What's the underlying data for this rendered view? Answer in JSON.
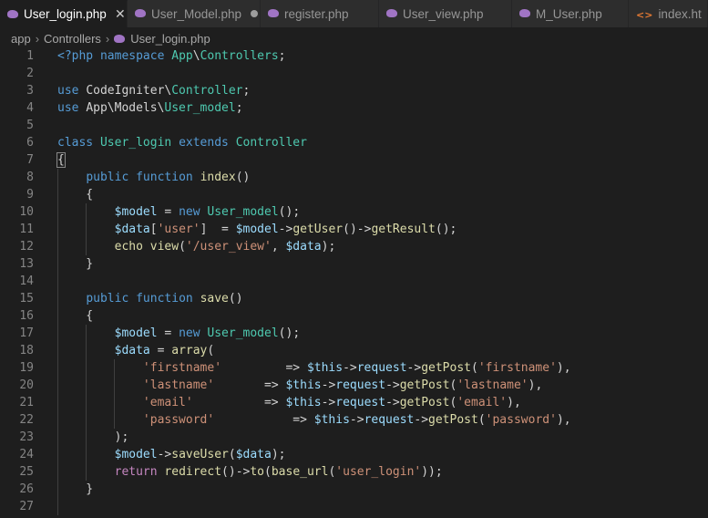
{
  "tabs": [
    {
      "label": "User_login.php",
      "icon": "php-file-icon",
      "active": true,
      "state": "close"
    },
    {
      "label": "User_Model.php",
      "icon": "php-file-icon",
      "active": false,
      "state": "modified"
    },
    {
      "label": "register.php",
      "icon": "php-file-icon",
      "active": false,
      "state": ""
    },
    {
      "label": "User_view.php",
      "icon": "php-file-icon",
      "active": false,
      "state": ""
    },
    {
      "label": "M_User.php",
      "icon": "php-file-icon",
      "active": false,
      "state": ""
    },
    {
      "label": "index.ht",
      "icon": "html-file-icon",
      "active": false,
      "state": ""
    }
  ],
  "breadcrumb": {
    "items": [
      "app",
      "Controllers",
      "User_login.php"
    ]
  },
  "editor": {
    "lines": [
      {
        "n": "1",
        "t": [
          [
            "kw",
            "<?php "
          ],
          [
            "kw",
            "namespace "
          ],
          [
            "cls",
            "App"
          ],
          [
            "plain",
            "\\"
          ],
          [
            "cls",
            "Controllers"
          ],
          [
            "plain",
            ";"
          ]
        ]
      },
      {
        "n": "2",
        "t": []
      },
      {
        "n": "3",
        "t": [
          [
            "kw",
            "use "
          ],
          [
            "plain",
            "CodeIgniter\\"
          ],
          [
            "cls",
            "Controller"
          ],
          [
            "plain",
            ";"
          ]
        ]
      },
      {
        "n": "4",
        "t": [
          [
            "kw",
            "use "
          ],
          [
            "plain",
            "App\\Models\\"
          ],
          [
            "cls",
            "User_model"
          ],
          [
            "plain",
            ";"
          ]
        ]
      },
      {
        "n": "5",
        "t": []
      },
      {
        "n": "6",
        "t": [
          [
            "kw",
            "class "
          ],
          [
            "cls",
            "User_login "
          ],
          [
            "kw",
            "extends "
          ],
          [
            "cls",
            "Controller"
          ]
        ]
      },
      {
        "n": "7",
        "t": [
          [
            "plain",
            "{"
          ]
        ]
      },
      {
        "n": "8",
        "t": [
          [
            "plain",
            "    "
          ],
          [
            "kw",
            "public "
          ],
          [
            "kw",
            "function "
          ],
          [
            "fn",
            "index"
          ],
          [
            "plain",
            "()"
          ]
        ]
      },
      {
        "n": "9",
        "t": [
          [
            "plain",
            "    {"
          ]
        ]
      },
      {
        "n": "10",
        "t": [
          [
            "plain",
            "        "
          ],
          [
            "var",
            "$model"
          ],
          [
            "plain",
            " = "
          ],
          [
            "kw",
            "new "
          ],
          [
            "cls",
            "User_model"
          ],
          [
            "plain",
            "();"
          ]
        ]
      },
      {
        "n": "11",
        "t": [
          [
            "plain",
            "        "
          ],
          [
            "var",
            "$data"
          ],
          [
            "plain",
            "["
          ],
          [
            "str",
            "'user'"
          ],
          [
            "plain",
            "]  = "
          ],
          [
            "var",
            "$model"
          ],
          [
            "plain",
            "->"
          ],
          [
            "fn",
            "getUser"
          ],
          [
            "plain",
            "()->"
          ],
          [
            "fn",
            "getResult"
          ],
          [
            "plain",
            "();"
          ]
        ]
      },
      {
        "n": "12",
        "t": [
          [
            "plain",
            "        "
          ],
          [
            "fn",
            "echo "
          ],
          [
            "fn",
            "view"
          ],
          [
            "plain",
            "("
          ],
          [
            "str",
            "'/user_view'"
          ],
          [
            "plain",
            ", "
          ],
          [
            "var",
            "$data"
          ],
          [
            "plain",
            ");"
          ]
        ]
      },
      {
        "n": "13",
        "t": [
          [
            "plain",
            "    }"
          ]
        ]
      },
      {
        "n": "14",
        "t": []
      },
      {
        "n": "15",
        "t": [
          [
            "plain",
            "    "
          ],
          [
            "kw",
            "public "
          ],
          [
            "kw",
            "function "
          ],
          [
            "fn",
            "save"
          ],
          [
            "plain",
            "()"
          ]
        ]
      },
      {
        "n": "16",
        "t": [
          [
            "plain",
            "    {"
          ]
        ]
      },
      {
        "n": "17",
        "t": [
          [
            "plain",
            "        "
          ],
          [
            "var",
            "$model"
          ],
          [
            "plain",
            " = "
          ],
          [
            "kw",
            "new "
          ],
          [
            "cls",
            "User_model"
          ],
          [
            "plain",
            "();"
          ]
        ]
      },
      {
        "n": "18",
        "t": [
          [
            "plain",
            "        "
          ],
          [
            "var",
            "$data"
          ],
          [
            "plain",
            " = "
          ],
          [
            "fn",
            "array"
          ],
          [
            "plain",
            "("
          ]
        ]
      },
      {
        "n": "19",
        "t": [
          [
            "plain",
            "            "
          ],
          [
            "str",
            "'firstname'"
          ],
          [
            "plain",
            "         => "
          ],
          [
            "var",
            "$this"
          ],
          [
            "plain",
            "->"
          ],
          [
            "var",
            "request"
          ],
          [
            "plain",
            "->"
          ],
          [
            "fn",
            "getPost"
          ],
          [
            "plain",
            "("
          ],
          [
            "str",
            "'firstname'"
          ],
          [
            "plain",
            "),"
          ]
        ]
      },
      {
        "n": "20",
        "t": [
          [
            "plain",
            "            "
          ],
          [
            "str",
            "'lastname'"
          ],
          [
            "plain",
            "       => "
          ],
          [
            "var",
            "$this"
          ],
          [
            "plain",
            "->"
          ],
          [
            "var",
            "request"
          ],
          [
            "plain",
            "->"
          ],
          [
            "fn",
            "getPost"
          ],
          [
            "plain",
            "("
          ],
          [
            "str",
            "'lastname'"
          ],
          [
            "plain",
            "),"
          ]
        ]
      },
      {
        "n": "21",
        "t": [
          [
            "plain",
            "            "
          ],
          [
            "str",
            "'email'"
          ],
          [
            "plain",
            "          => "
          ],
          [
            "var",
            "$this"
          ],
          [
            "plain",
            "->"
          ],
          [
            "var",
            "request"
          ],
          [
            "plain",
            "->"
          ],
          [
            "fn",
            "getPost"
          ],
          [
            "plain",
            "("
          ],
          [
            "str",
            "'email'"
          ],
          [
            "plain",
            "),"
          ]
        ]
      },
      {
        "n": "22",
        "t": [
          [
            "plain",
            "            "
          ],
          [
            "str",
            "'password'"
          ],
          [
            "plain",
            "           => "
          ],
          [
            "var",
            "$this"
          ],
          [
            "plain",
            "->"
          ],
          [
            "var",
            "request"
          ],
          [
            "plain",
            "->"
          ],
          [
            "fn",
            "getPost"
          ],
          [
            "plain",
            "("
          ],
          [
            "str",
            "'password'"
          ],
          [
            "plain",
            "),"
          ]
        ]
      },
      {
        "n": "23",
        "t": [
          [
            "plain",
            "        );"
          ]
        ]
      },
      {
        "n": "24",
        "t": [
          [
            "plain",
            "        "
          ],
          [
            "var",
            "$model"
          ],
          [
            "plain",
            "->"
          ],
          [
            "fn",
            "saveUser"
          ],
          [
            "plain",
            "("
          ],
          [
            "var",
            "$data"
          ],
          [
            "plain",
            ");"
          ]
        ]
      },
      {
        "n": "25",
        "t": [
          [
            "plain",
            "        "
          ],
          [
            "ctrl",
            "return "
          ],
          [
            "fn",
            "redirect"
          ],
          [
            "plain",
            "()->"
          ],
          [
            "fn",
            "to"
          ],
          [
            "plain",
            "("
          ],
          [
            "fn",
            "base_url"
          ],
          [
            "plain",
            "("
          ],
          [
            "str",
            "'user_login'"
          ],
          [
            "plain",
            "));"
          ]
        ]
      },
      {
        "n": "26",
        "t": [
          [
            "plain",
            "    }"
          ]
        ]
      },
      {
        "n": "27",
        "t": []
      }
    ]
  }
}
